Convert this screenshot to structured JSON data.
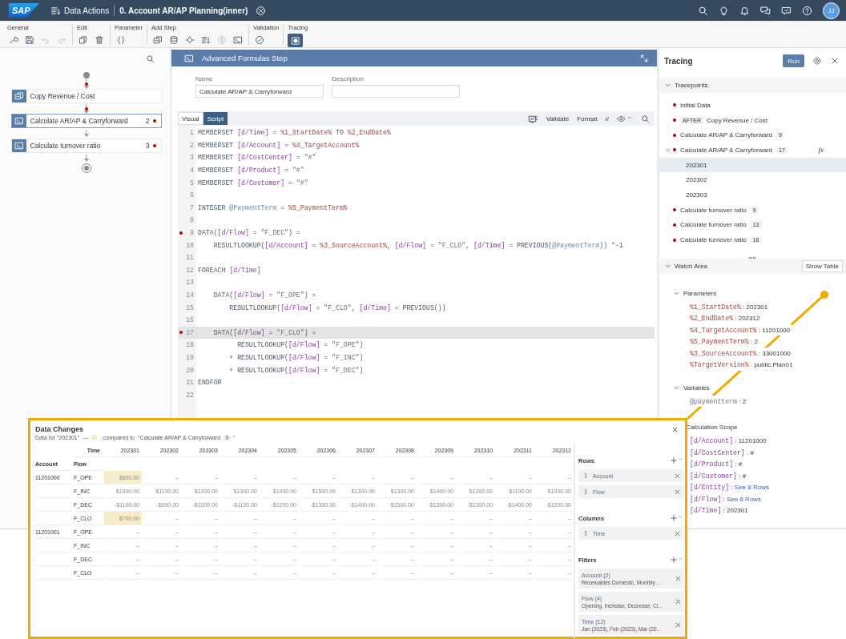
{
  "shell": {
    "logo": "SAP",
    "app": "Data Actions",
    "document": "0. Account AR/AP Planning(inner)",
    "avatar": "JJ"
  },
  "toolbar": {
    "groups": [
      {
        "label": "General",
        "buttons": [
          {
            "disabled": false
          },
          {
            "disabled": false
          },
          {
            "disabled": true
          },
          {
            "disabled": true
          }
        ]
      },
      {
        "label": "Edit",
        "buttons": [
          {
            "disabled": false
          },
          {
            "disabled": false
          }
        ]
      },
      {
        "label": "Parameter",
        "buttons": [
          {
            "disabled": false
          }
        ]
      },
      {
        "label": "Add Step",
        "buttons": [
          {
            "disabled": false
          },
          {
            "disabled": false
          },
          {
            "disabled": false
          },
          {
            "disabled": false
          },
          {
            "disabled": true
          },
          {
            "disabled": false
          }
        ]
      },
      {
        "label": "Validation",
        "buttons": [
          {
            "disabled": false
          }
        ]
      },
      {
        "label": "Tracing",
        "toggle": {
          "on": true
        }
      }
    ]
  },
  "flow": {
    "connectors": [
      {
        "breakpoint": true
      },
      {
        "breakpoint": true
      },
      {
        "breakpoint": false
      },
      {
        "breakpoint": false
      }
    ],
    "nodes": [
      {
        "kind": "copy",
        "label": "Copy Revenue / Cost",
        "selected": false,
        "breakpoint": false
      },
      {
        "kind": "formula",
        "label": "Calculate AR/AP & Carryforward",
        "count": "2",
        "selected": true,
        "breakpoint": true
      },
      {
        "kind": "formula",
        "label": "Calculate turnover ratio",
        "count": "3",
        "selected": false,
        "breakpoint": true
      }
    ]
  },
  "editor": {
    "title": "Advanced Formulas Step",
    "name_label": "Name",
    "name_value": "Calculate AR/AP & Carryforward",
    "description_label": "Description",
    "tabs": [
      {
        "label": "Visual",
        "selected": false
      },
      {
        "label": "Script",
        "selected": true
      }
    ],
    "validate": "Validate",
    "format": "Format",
    "comment": "//",
    "lines": [
      {
        "number": "1",
        "text": "MEMBERSET [d/Time] = %1_StartDate% TO %2_EndDate%",
        "breakpoint": false,
        "selected": false
      },
      {
        "number": "2",
        "text": "MEMBERSET [d/Account] = %4_TargetAccount%",
        "breakpoint": false,
        "selected": false
      },
      {
        "number": "3",
        "text": "MEMBERSET [d/CostCenter] = \"#\"",
        "breakpoint": false,
        "selected": false
      },
      {
        "number": "4",
        "text": "MEMBERSET [d/Product] = \"#\"",
        "breakpoint": false,
        "selected": false
      },
      {
        "number": "5",
        "text": "MEMBERSET [d/Customer] = \"#\"",
        "breakpoint": false,
        "selected": false
      },
      {
        "number": "6",
        "breakpoint": false,
        "selected": false
      },
      {
        "number": "7",
        "text": "INTEGER @PaymentTerm = %5_PaymentTerm%",
        "breakpoint": false,
        "selected": false
      },
      {
        "number": "8",
        "breakpoint": false,
        "selected": false
      },
      {
        "number": "9",
        "text": "DATA([d/Flow] = \"F_DEC\") =",
        "breakpoint": true,
        "selected": false
      },
      {
        "number": "10",
        "text": "    RESULTLOOKUP([d/Account] = %3_SourceAccount%, [d/Flow] = \"F_CLO\", [d/Time] = PREVIOUS(@PaymentTerm)) *-1",
        "breakpoint": false,
        "selected": false
      },
      {
        "number": "11",
        "breakpoint": false,
        "selected": false
      },
      {
        "number": "12",
        "text": "FOREACH [d/Time]",
        "breakpoint": false,
        "selected": false
      },
      {
        "number": "13",
        "breakpoint": false,
        "selected": false
      },
      {
        "number": "14",
        "text": "    DATA([d/Flow] = \"F_OPE\") =",
        "breakpoint": false,
        "selected": false
      },
      {
        "number": "15",
        "text": "        RESULTLOOKUP([d/Flow] = \"F_CLO\", [d/Time] = PREVIOUS())",
        "breakpoint": false,
        "selected": false
      },
      {
        "number": "16",
        "breakpoint": false,
        "selected": false
      },
      {
        "number": "17",
        "text": "    DATA([d/Flow] = \"F_CLO\") =",
        "breakpoint": true,
        "selected": true
      },
      {
        "number": "18",
        "text": "          RESULTLOOKUP([d/Flow] = \"F_OPE\")",
        "breakpoint": false,
        "selected": false
      },
      {
        "number": "19",
        "text": "        + RESULTLOOKUP([d/Flow] = \"F_INC\")",
        "breakpoint": false,
        "selected": false
      },
      {
        "number": "20",
        "text": "        + RESULTLOOKUP([d/Flow] = \"F_DEC\")",
        "breakpoint": false,
        "selected": false
      },
      {
        "number": "21",
        "text": "ENDFOR",
        "breakpoint": false,
        "selected": false
      },
      {
        "number": "22",
        "breakpoint": false,
        "selected": false
      }
    ]
  },
  "tracing": {
    "title": "Tracing",
    "run": "Run",
    "tracepoints": {
      "label": "Tracepoints",
      "expanded": true,
      "items": [
        {
          "label": "Initial Data",
          "breakpoint": true,
          "expanded": false,
          "selected": false
        },
        {
          "tag": "AFTER",
          "label": "Copy Revenue / Cost",
          "breakpoint": true,
          "expanded": false,
          "selected": false
        },
        {
          "label": "Calculate AR/AP & Carryforward",
          "badge": "9",
          "breakpoint": true,
          "expanded": false,
          "selected": false
        },
        {
          "label": "Calculate AR/AP & Carryforward",
          "badge": "17",
          "formula": "fx",
          "breakpoint": true,
          "expanded": true,
          "selected": false,
          "children": [
            {
              "label": "202301",
              "selected": true
            },
            {
              "label": "202302",
              "selected": false
            },
            {
              "label": "202303",
              "selected": false
            }
          ]
        },
        {
          "label": "Calculate turnover ratio",
          "badge": "9",
          "breakpoint": true,
          "expanded": false,
          "selected": false
        },
        {
          "label": "Calculate turnover ratio",
          "badge": "13",
          "breakpoint": true,
          "expanded": false,
          "selected": false
        },
        {
          "label": "Calculate turnover ratio",
          "badge": "16",
          "breakpoint": true,
          "expanded": false,
          "selected": false
        }
      ]
    },
    "watch": {
      "label": "Watch Area",
      "expanded": true,
      "show_table": "Show Table",
      "separator": ":",
      "groups": [
        {
          "label": "Parameters",
          "kind": "parameter",
          "expanded": true,
          "entries": [
            {
              "name": "%1_StartDate%",
              "value": "202301",
              "link": false
            },
            {
              "name": "%2_EndDate%",
              "value": "202312",
              "link": false
            },
            {
              "name": "%4_TargetAccount%",
              "value": "11201000",
              "link": false
            },
            {
              "name": "%5_PaymentTerm%",
              "value": "2",
              "link": false
            },
            {
              "name": "%3_SourceAccount%",
              "value": "33001000",
              "link": false
            },
            {
              "name": "%TargetVersion%",
              "value": "public.Plan01",
              "link": false
            }
          ]
        },
        {
          "label": "Variables",
          "kind": "variable",
          "expanded": true,
          "entries": [
            {
              "name": "@paymentterm",
              "value": "2",
              "link": false
            }
          ]
        },
        {
          "label": "Calculation Scope",
          "kind": "scope",
          "entries": [
            {
              "name": "[d/Account]",
              "value": "11201000",
              "link": false
            },
            {
              "name": "[d/CostCenter]",
              "value": "#",
              "link": false
            },
            {
              "name": "[d/Product]",
              "value": "#",
              "link": false
            },
            {
              "name": "[d/Customer]",
              "value": "#",
              "link": false
            },
            {
              "name": "[d/Entity]",
              "value": "See 8 Rows",
              "link": true
            },
            {
              "name": "[d/Flow]",
              "value": "See 6 Rows",
              "link": true
            },
            {
              "name": "[d/Time]",
              "value": "202301",
              "link": false
            }
          ]
        }
      ]
    }
  },
  "data_changes": {
    "title": "Data Changes",
    "data_for": "Data for \"202301\"",
    "dash": "—",
    "compared": ": compared to",
    "reference": "\"Calculate AR/AP & Carryforward",
    "reference_badge": "9",
    "reference_end": "\"",
    "time_label": "Time",
    "account_label": "Account",
    "flow_label": "Flow",
    "columns": [
      "202301",
      "202302",
      "202303",
      "202304",
      "202305",
      "202306",
      "202307",
      "202308",
      "202309",
      "202310",
      "202311",
      "202312"
    ],
    "rows": [
      {
        "account": "11201000",
        "flow": "F_OPE",
        "cells": [
          {
            "value": "$800.00",
            "changed": true
          },
          {
            "value": "–",
            "changed": false
          },
          {
            "value": "–",
            "changed": false
          },
          {
            "value": "–",
            "changed": false
          },
          {
            "value": "–",
            "changed": false
          },
          {
            "value": "–",
            "changed": false
          },
          {
            "value": "–",
            "changed": false
          },
          {
            "value": "–",
            "changed": false
          },
          {
            "value": "–",
            "changed": false
          },
          {
            "value": "–",
            "changed": false
          },
          {
            "value": "–",
            "changed": false
          },
          {
            "value": "–",
            "changed": false
          }
        ]
      },
      {
        "flow": "F_INC",
        "cells": [
          {
            "value": "$1000.00",
            "changed": false
          },
          {
            "value": "$1100.00",
            "changed": false
          },
          {
            "value": "$1200.00",
            "changed": false
          },
          {
            "value": "$1300.00",
            "changed": false
          },
          {
            "value": "$1400.00",
            "changed": false
          },
          {
            "value": "$1500.00",
            "changed": false
          },
          {
            "value": "$1300.00",
            "changed": false
          },
          {
            "value": "$1300.00",
            "changed": false
          },
          {
            "value": "$1400.00",
            "changed": false
          },
          {
            "value": "$1200.00",
            "changed": false
          },
          {
            "value": "$1100.00",
            "changed": false
          },
          {
            "value": "$1000.00",
            "changed": false
          }
        ]
      },
      {
        "flow": "F_DEC",
        "cells": [
          {
            "value": "-$1100.00",
            "changed": false
          },
          {
            "value": "-$900.00",
            "changed": false
          },
          {
            "value": "-$1000.00",
            "changed": false
          },
          {
            "value": "-$1100.00",
            "changed": false
          },
          {
            "value": "-$1200.00",
            "changed": false
          },
          {
            "value": "-$1300.00",
            "changed": false
          },
          {
            "value": "-$1400.00",
            "changed": false
          },
          {
            "value": "-$1500.00",
            "changed": false
          },
          {
            "value": "-$1300.00",
            "changed": false
          },
          {
            "value": "-$1300.00",
            "changed": false
          },
          {
            "value": "-$1400.00",
            "changed": false
          },
          {
            "value": "-$1200.00",
            "changed": false
          }
        ]
      },
      {
        "flow": "F_CLO",
        "cells": [
          {
            "value": "$700.00",
            "changed": true
          },
          {
            "value": "–",
            "changed": false
          },
          {
            "value": "–",
            "changed": false
          },
          {
            "value": "–",
            "changed": false
          },
          {
            "value": "–",
            "changed": false
          },
          {
            "value": "–",
            "changed": false
          },
          {
            "value": "–",
            "changed": false
          },
          {
            "value": "–",
            "changed": false
          },
          {
            "value": "–",
            "changed": false
          },
          {
            "value": "–",
            "changed": false
          },
          {
            "value": "–",
            "changed": false
          },
          {
            "value": "–",
            "changed": false
          }
        ]
      },
      {
        "account": "11201001",
        "flow": "F_OPE",
        "cells": [
          {
            "value": "–",
            "changed": false
          },
          {
            "value": "–",
            "changed": false
          },
          {
            "value": "–",
            "changed": false
          },
          {
            "value": "–",
            "changed": false
          },
          {
            "value": "–",
            "changed": false
          },
          {
            "value": "–",
            "changed": false
          },
          {
            "value": "–",
            "changed": false
          },
          {
            "value": "–",
            "changed": false
          },
          {
            "value": "–",
            "changed": false
          },
          {
            "value": "–",
            "changed": false
          },
          {
            "value": "–",
            "changed": false
          },
          {
            "value": "–",
            "changed": false
          }
        ]
      },
      {
        "flow": "F_INC",
        "cells": [
          {
            "value": "–",
            "changed": false
          },
          {
            "value": "–",
            "changed": false
          },
          {
            "value": "–",
            "changed": false
          },
          {
            "value": "–",
            "changed": false
          },
          {
            "value": "–",
            "changed": false
          },
          {
            "value": "–",
            "changed": false
          },
          {
            "value": "–",
            "changed": false
          },
          {
            "value": "–",
            "changed": false
          },
          {
            "value": "–",
            "changed": false
          },
          {
            "value": "–",
            "changed": false
          },
          {
            "value": "–",
            "changed": false
          },
          {
            "value": "–",
            "changed": false
          }
        ]
      },
      {
        "flow": "F_DEC",
        "cells": [
          {
            "value": "–",
            "changed": false
          },
          {
            "value": "–",
            "changed": false
          },
          {
            "value": "–",
            "changed": false
          },
          {
            "value": "–",
            "changed": false
          },
          {
            "value": "–",
            "changed": false
          },
          {
            "value": "–",
            "changed": false
          },
          {
            "value": "–",
            "changed": false
          },
          {
            "value": "–",
            "changed": false
          },
          {
            "value": "–",
            "changed": false
          },
          {
            "value": "–",
            "changed": false
          },
          {
            "value": "–",
            "changed": false
          },
          {
            "value": "–",
            "changed": false
          }
        ]
      },
      {
        "flow": "F_CLO",
        "cells": [
          {
            "value": "–",
            "changed": false
          },
          {
            "value": "–",
            "changed": false
          },
          {
            "value": "–",
            "changed": false
          },
          {
            "value": "–",
            "changed": false
          },
          {
            "value": "–",
            "changed": false
          },
          {
            "value": "–",
            "changed": false
          },
          {
            "value": "–",
            "changed": false
          },
          {
            "value": "–",
            "changed": false
          },
          {
            "value": "–",
            "changed": false
          },
          {
            "value": "–",
            "changed": false
          },
          {
            "value": "–",
            "changed": false
          },
          {
            "value": "–",
            "changed": false
          }
        ]
      }
    ],
    "sections": [
      {
        "label": "Rows",
        "chips": [
          {
            "label": "Account"
          },
          {
            "label": "Flow"
          }
        ]
      },
      {
        "label": "Columns",
        "chips": [
          {
            "label": "Time"
          }
        ]
      },
      {
        "label": "Filters",
        "chips": [
          {
            "label": "Account (2)",
            "detail": "Receivables Domestic, Monthly ..."
          },
          {
            "label": "Flow (4)",
            "detail": "Opening, Increase, Decrease, Cl..."
          },
          {
            "label": "Time (12)",
            "detail": "Jan (2023), Feb (2023), Mar (20..."
          }
        ]
      }
    ]
  }
}
